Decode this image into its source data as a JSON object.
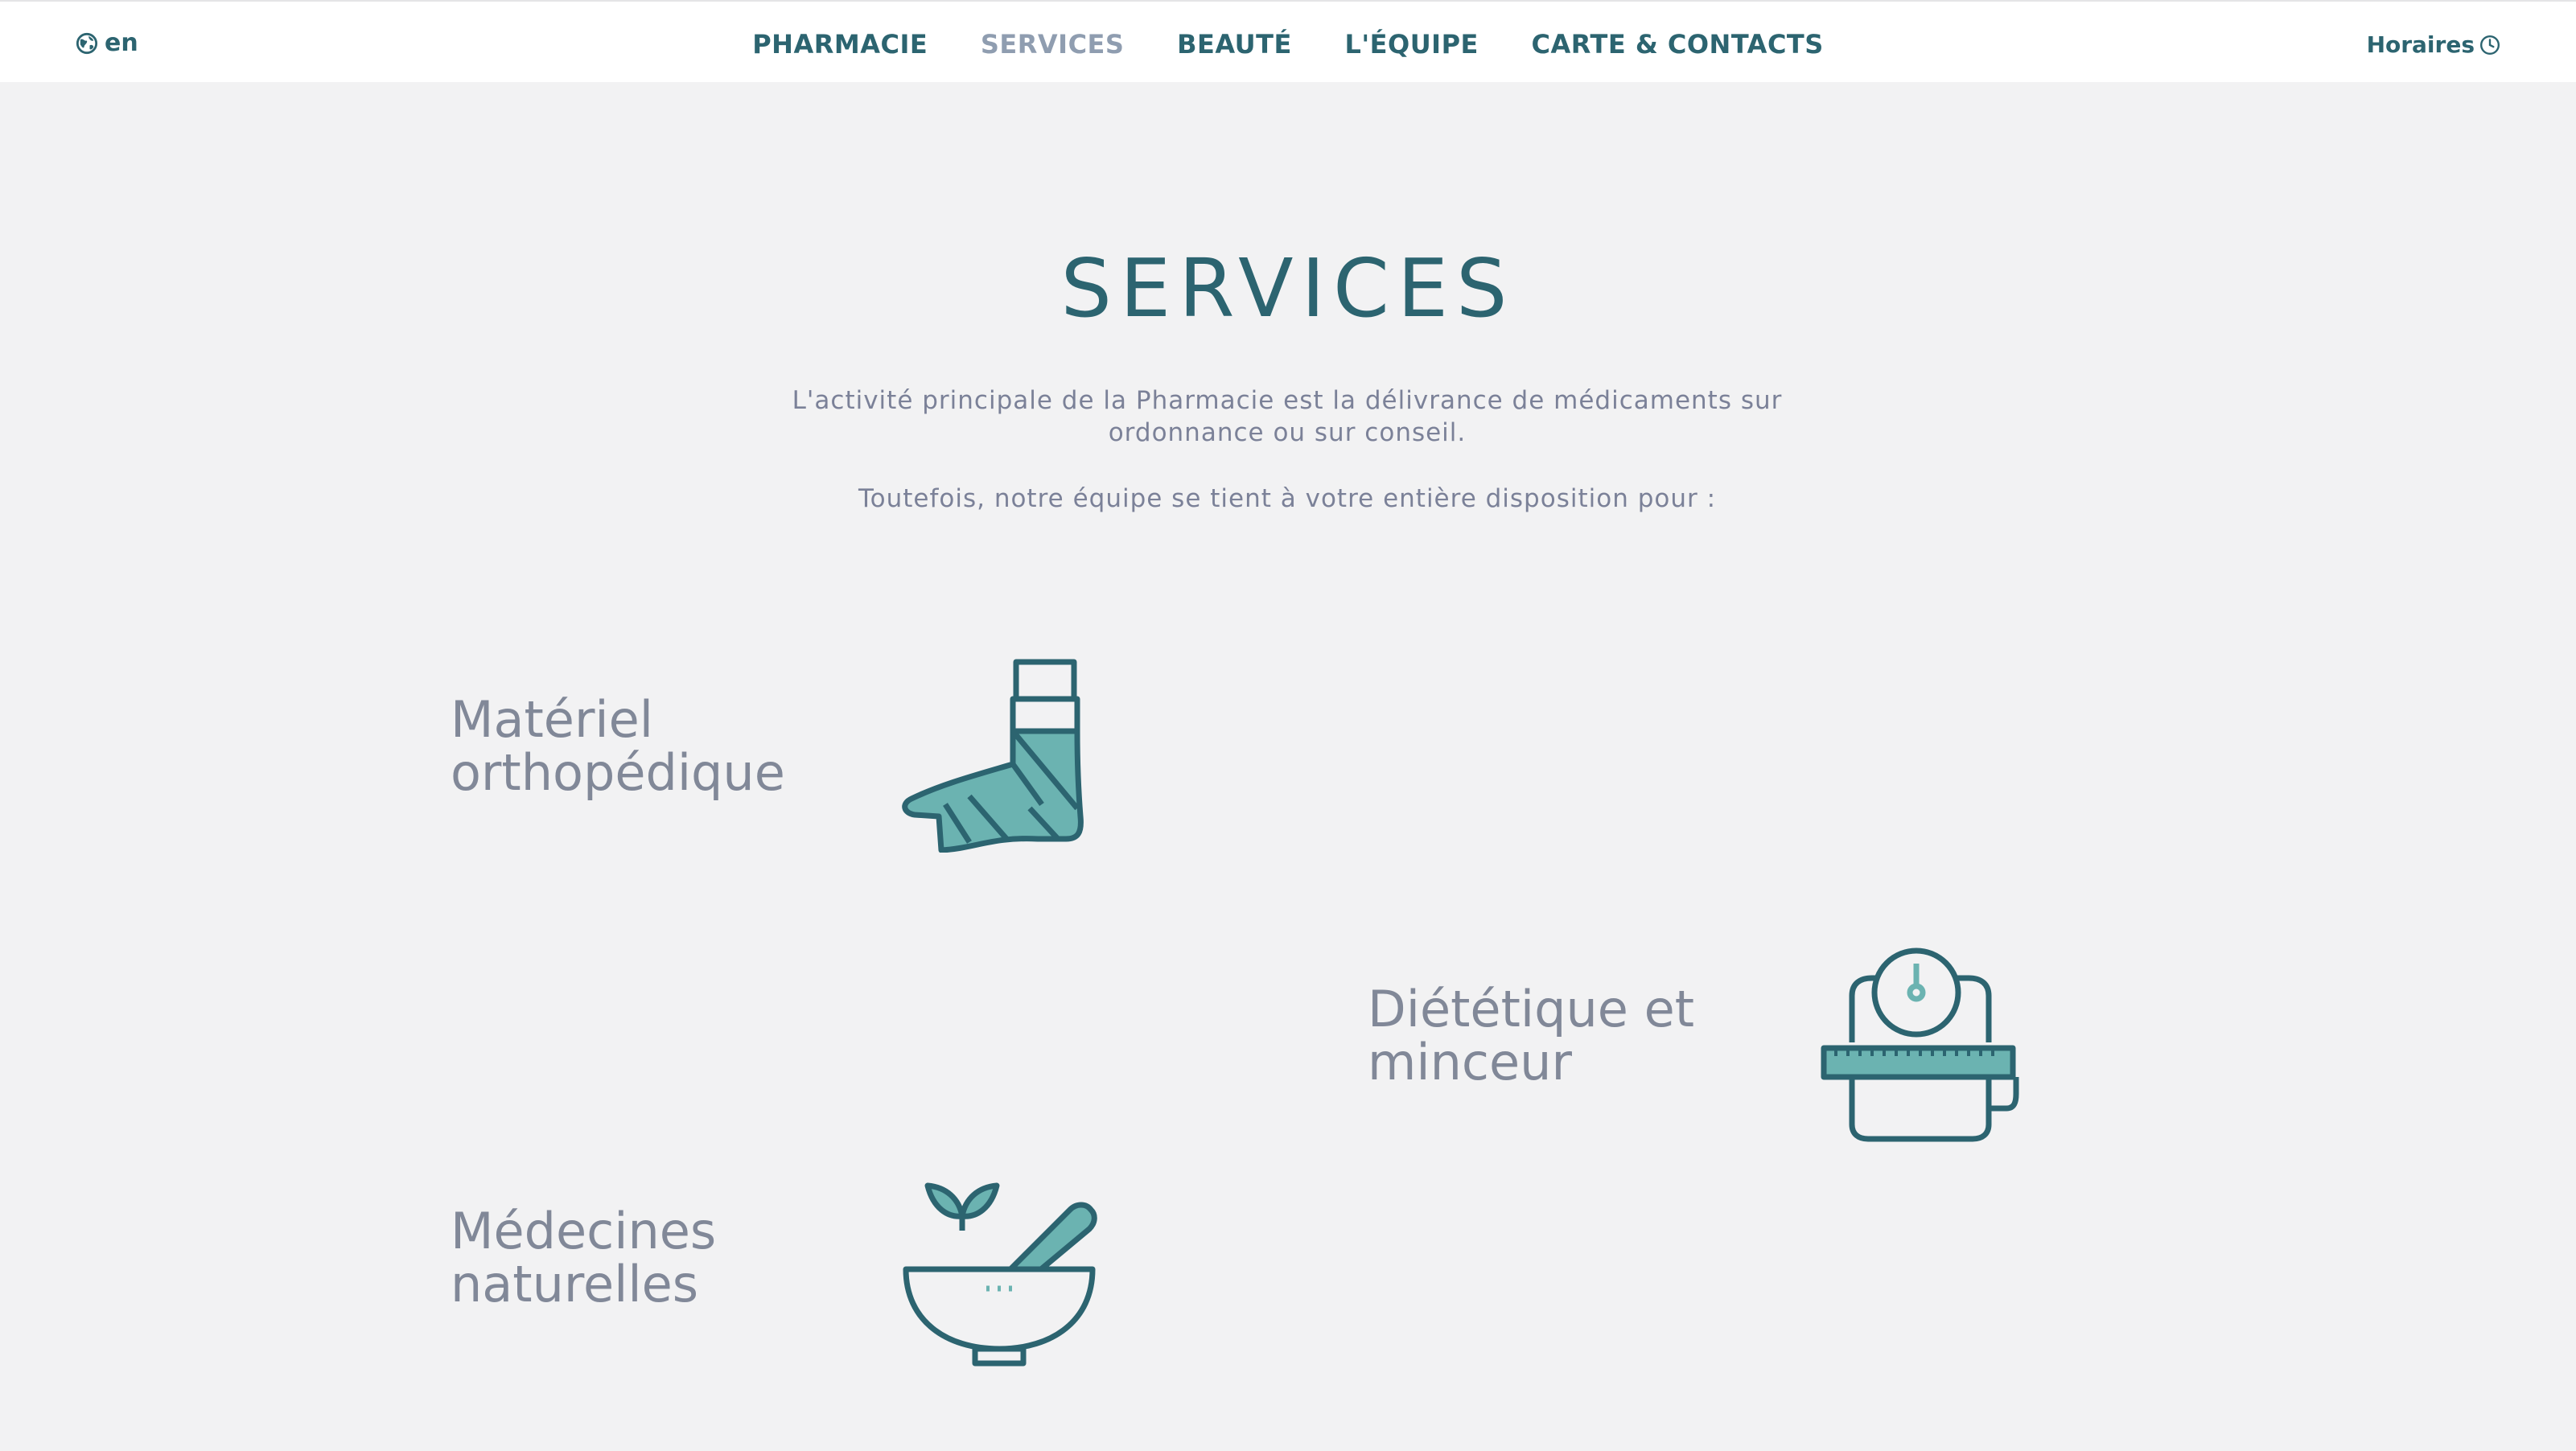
{
  "header": {
    "lang": "en",
    "nav": [
      "PHARMACIE",
      "SERVICES",
      "BEAUTÉ",
      "L'ÉQUIPE",
      "CARTE & CONTACTS"
    ],
    "hours": "Horaires"
  },
  "page": {
    "title": "SERVICES",
    "intro_line1": "L'activité principale de la Pharmacie est la délivrance de médicaments sur ordonnance ou sur conseil.",
    "intro_line2": "Toutefois, notre équipe se tient à votre entière disposition pour :"
  },
  "services": [
    {
      "label": "Matériel orthopédique",
      "icon": "bandaged-foot-icon"
    },
    {
      "label": "Diététique et minceur",
      "icon": "scale-measuring-tape-icon"
    },
    {
      "label": "Médecines naturelles",
      "icon": "mortar-pestle-herb-icon"
    }
  ],
  "colors": {
    "accent": "#2c6470",
    "accent_light": "#6bb3b1",
    "nav_active": "#8f9db0",
    "text_muted": "#7b8198",
    "background": "#f2f2f3"
  }
}
